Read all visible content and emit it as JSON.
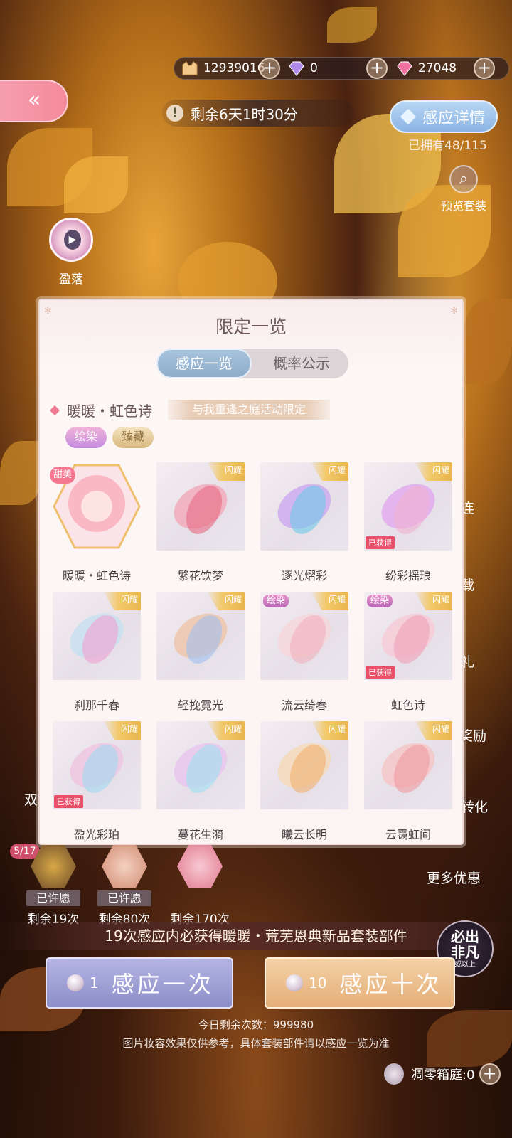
{
  "currency": {
    "gold": "12939016",
    "diamond": "0",
    "crystal": "27048"
  },
  "timer": {
    "text": "剩余6天1时30分"
  },
  "detail_button": "感应详情",
  "owned": "已拥有48/115",
  "preview_label": "预览套装",
  "yingluo_label": "盈落",
  "side": [
    "连",
    "载",
    "礼",
    "奖励",
    "转化",
    "更多优惠"
  ],
  "left_side_label": "双",
  "panel": {
    "title": "限定一览",
    "tabs": [
      "感应一览",
      "概率公示"
    ],
    "suit_name": "暖暖・虹色诗",
    "suit_tag": "与我重逢之庭活动限定",
    "badges": [
      "绘染",
      "臻藏"
    ],
    "items": [
      {
        "name": "暖暖・虹色诗",
        "tag": "甜美",
        "ribbon": "闪耀",
        "obtained": false,
        "dye": false
      },
      {
        "name": "繁花饮梦",
        "ribbon": "闪耀",
        "obtained": false,
        "dye": false
      },
      {
        "name": "逐光熠彩",
        "ribbon": "闪耀",
        "obtained": false,
        "dye": false
      },
      {
        "name": "纷彩摇琅",
        "ribbon": "闪耀",
        "obtained": true,
        "dye": false
      },
      {
        "name": "刹那千春",
        "ribbon": "闪耀",
        "obtained": false,
        "dye": false
      },
      {
        "name": "轻挽霓光",
        "ribbon": "闪耀",
        "obtained": false,
        "dye": false
      },
      {
        "name": "流云绮春",
        "ribbon": "闪耀",
        "obtained": false,
        "dye": true
      },
      {
        "name": "虹色诗",
        "ribbon": "闪耀",
        "obtained": true,
        "dye": true
      },
      {
        "name": "盈光彩珀",
        "ribbon": "闪耀",
        "obtained": true,
        "dye": false
      },
      {
        "name": "蔓花生漪",
        "ribbon": "闪耀",
        "obtained": false,
        "dye": false
      },
      {
        "name": "曦云长明",
        "ribbon": "闪耀",
        "obtained": false,
        "dye": false
      },
      {
        "name": "云霭虹间",
        "ribbon": "闪耀",
        "obtained": false,
        "dye": false
      }
    ],
    "obtained_label": "已获得",
    "dye_label": "绘染"
  },
  "wishes": [
    {
      "status": "已许愿",
      "remaining": "剩余19次",
      "count": "5/17"
    },
    {
      "status": "已许愿",
      "remaining": "剩余80次"
    },
    {
      "remaining": "剩余170次"
    }
  ],
  "guarantee": "19次感应内必获得暖暖・荒芜恩典新品套装部件",
  "bifan": {
    "line1": "必出",
    "line2": "非凡",
    "line3": "或以上"
  },
  "draw_once": {
    "count": "1",
    "label": "感应一次"
  },
  "draw_ten": {
    "count": "10",
    "label": "感应十次"
  },
  "remaining_today": "今日剩余次数：999980",
  "disclaimer": "图片妆容效果仅供参考，具体套装部件请以感应一览为准",
  "tree": "凋零箱庭:0",
  "colors": {
    "accent_pink": "#f58a9c",
    "accent_blue": "#8cb4e4",
    "obtained_red": "#e9506a"
  }
}
